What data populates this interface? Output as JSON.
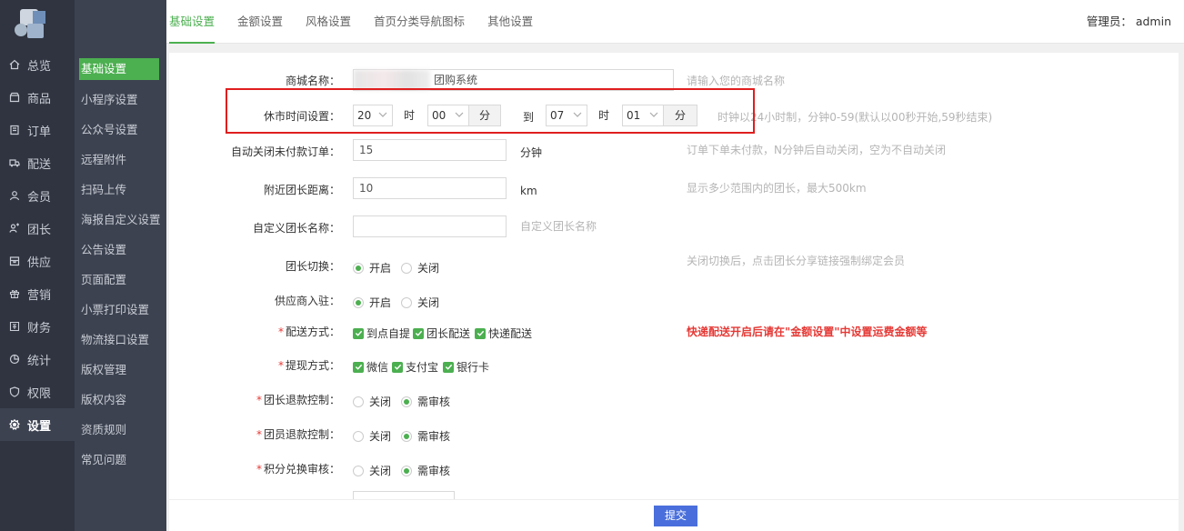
{
  "nav_main": [
    {
      "label": "总览",
      "icon": "home-icon"
    },
    {
      "label": "商品",
      "icon": "goods-icon"
    },
    {
      "label": "订单",
      "icon": "order-icon"
    },
    {
      "label": "配送",
      "icon": "truck-icon"
    },
    {
      "label": "会员",
      "icon": "user-icon"
    },
    {
      "label": "团长",
      "icon": "leader-icon"
    },
    {
      "label": "供应",
      "icon": "supply-icon"
    },
    {
      "label": "营销",
      "icon": "gift-icon"
    },
    {
      "label": "财务",
      "icon": "finance-icon"
    },
    {
      "label": "统计",
      "icon": "chart-icon"
    },
    {
      "label": "权限",
      "icon": "shield-icon"
    },
    {
      "label": "设置",
      "icon": "gear-icon",
      "active": true
    }
  ],
  "nav_sub": [
    "基础设置",
    "小程序设置",
    "公众号设置",
    "远程附件",
    "扫码上传",
    "海报自定义设置",
    "公告设置",
    "页面配置",
    "小票打印设置",
    "物流接口设置",
    "版权管理",
    "版权内容",
    "资质规则",
    "常见问题"
  ],
  "tabs": [
    "基础设置",
    "金额设置",
    "风格设置",
    "首页分类导航图标",
    "其他设置"
  ],
  "admin": "管理员： admin",
  "form": {
    "shop_name": {
      "label": "商城名称：",
      "value": "团购系统",
      "hint": "请输入您的商城名称"
    },
    "close_time": {
      "label": "休市时间设置：",
      "from_hour": "20",
      "hour_unit": "时",
      "from_min": "00",
      "min_unit": "分",
      "to": "到",
      "to_hour": "07",
      "to_min": "01",
      "hint": "时钟以24小时制，分钟0-59(默认以00秒开始,59秒结束)"
    },
    "auto_close": {
      "label": "自动关闭未付款订单：",
      "value": "15",
      "unit": "分钟",
      "hint": "订单下单未付款，N分钟后自动关闭，空为不自动关闭"
    },
    "distance": {
      "label": "附近团长距离：",
      "value": "10",
      "unit": "km",
      "hint": "显示多少范围内的团长，最大500km"
    },
    "leader_name": {
      "label": "自定义团长名称：",
      "value": "",
      "hint": "自定义团长名称"
    },
    "leader_switch": {
      "label": "团长切换：",
      "opt_on": "开启",
      "opt_off": "关闭",
      "hint": "关闭切换后，点击团长分享链接强制绑定会员"
    },
    "supplier": {
      "label": "供应商入驻：",
      "opt_on": "开启",
      "opt_off": "关闭"
    },
    "delivery": {
      "label": "配送方式：",
      "opts": [
        "到点自提",
        "团长配送",
        "快递配送"
      ],
      "warn": "快递配送开启后请在\"金额设置\"中设置运费金额等"
    },
    "withdraw": {
      "label": "提现方式：",
      "opts": [
        "微信",
        "支付宝",
        "银行卡"
      ]
    },
    "leader_refund": {
      "label": "团长退款控制：",
      "opt_a": "关闭",
      "opt_b": "需审核"
    },
    "member_refund": {
      "label": "团员退款控制：",
      "opt_a": "关闭",
      "opt_b": "需审核"
    },
    "points_audit": {
      "label": "积分兑换审核：",
      "opt_a": "关闭",
      "opt_b": "需审核"
    }
  },
  "submit": "提交"
}
